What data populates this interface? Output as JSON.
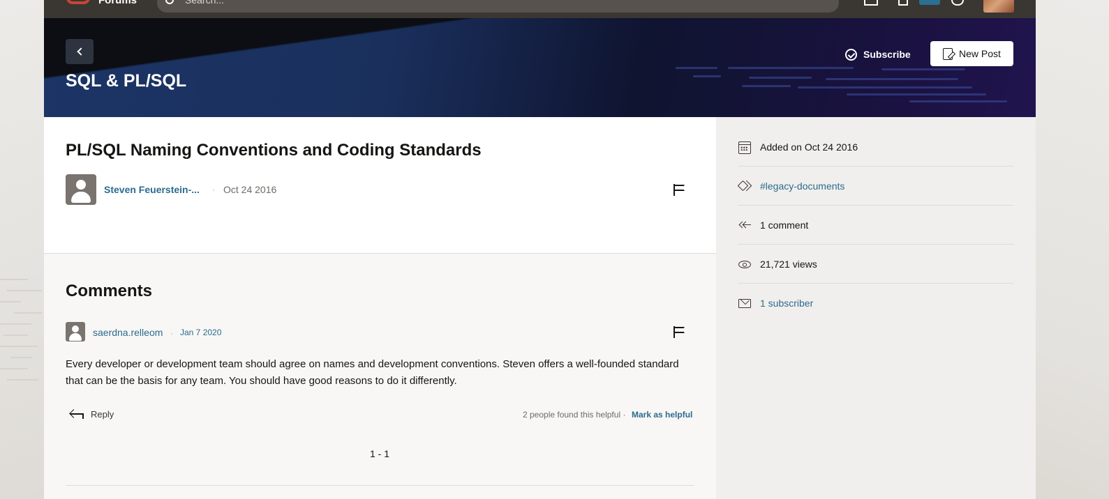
{
  "topbar": {
    "brand": "Forums",
    "search_placeholder": "Search..."
  },
  "banner": {
    "title": "SQL & PL/SQL",
    "subscribe_label": "Subscribe",
    "new_post_label": "New Post"
  },
  "article": {
    "title": "PL/SQL Naming Conventions and Coding Standards",
    "author": "Steven Feuerstein-...",
    "separator": "·",
    "date": "Oct 24 2016"
  },
  "comments": {
    "heading": "Comments",
    "items": [
      {
        "author": "saerdna.relleom",
        "separator": "·",
        "date": "Jan 7 2020",
        "body": "Every developer or development team should agree on names and development conventions. Steven offers a well-founded standard that can be the basis for any team. You should have good reasons to do it differently.",
        "reply_label": "Reply",
        "helpful_text": "2 people found this helpful ·",
        "mark_helpful_label": "Mark as helpful"
      }
    ],
    "pagination": "1 - 1"
  },
  "sidebar": {
    "added": "Added on Oct 24 2016",
    "tag": "#legacy-documents",
    "comments": "1 comment",
    "views": "21,721 views",
    "subscribers": "1 subscriber"
  },
  "colors": {
    "link": "#2b6b8e",
    "brand_red": "#c74634",
    "topbar": "#3a3632",
    "banner_blue": "#1c3566"
  }
}
